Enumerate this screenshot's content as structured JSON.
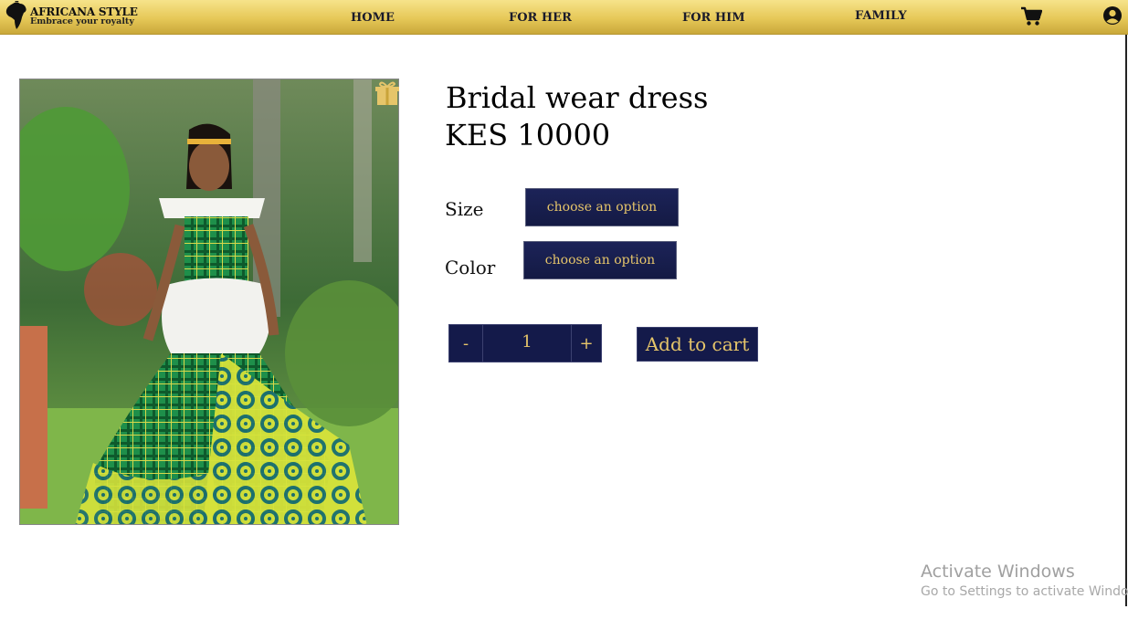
{
  "brand": {
    "name": "AFRICANA STYLE",
    "tagline": "Embrace your royalty",
    "logo_icon": "africa-map-icon"
  },
  "nav": {
    "items": [
      {
        "label": "HOME"
      },
      {
        "label": "FOR HER"
      },
      {
        "label": "FOR HIM"
      },
      {
        "label": "FAMILY"
      }
    ],
    "cart_icon": "cart-icon",
    "account_icon": "user-circle-icon"
  },
  "product": {
    "title": "Bridal wear dress",
    "price": "KES 10000",
    "image_icon": "gift-icon",
    "size": {
      "label": "Size",
      "select_text": "choose an option"
    },
    "color": {
      "label": "Color",
      "select_text": "choose an option"
    },
    "quantity": {
      "minus": "-",
      "value": "1",
      "plus": "+"
    },
    "add_to_cart": "Add to cart"
  },
  "watermark": {
    "title": "Activate Windows",
    "subtitle": "Go to Settings to activate Windows."
  },
  "colors": {
    "nav_gold": "#e6c858",
    "button_navy": "#141a4a",
    "button_text_gold": "#e6c56a"
  }
}
